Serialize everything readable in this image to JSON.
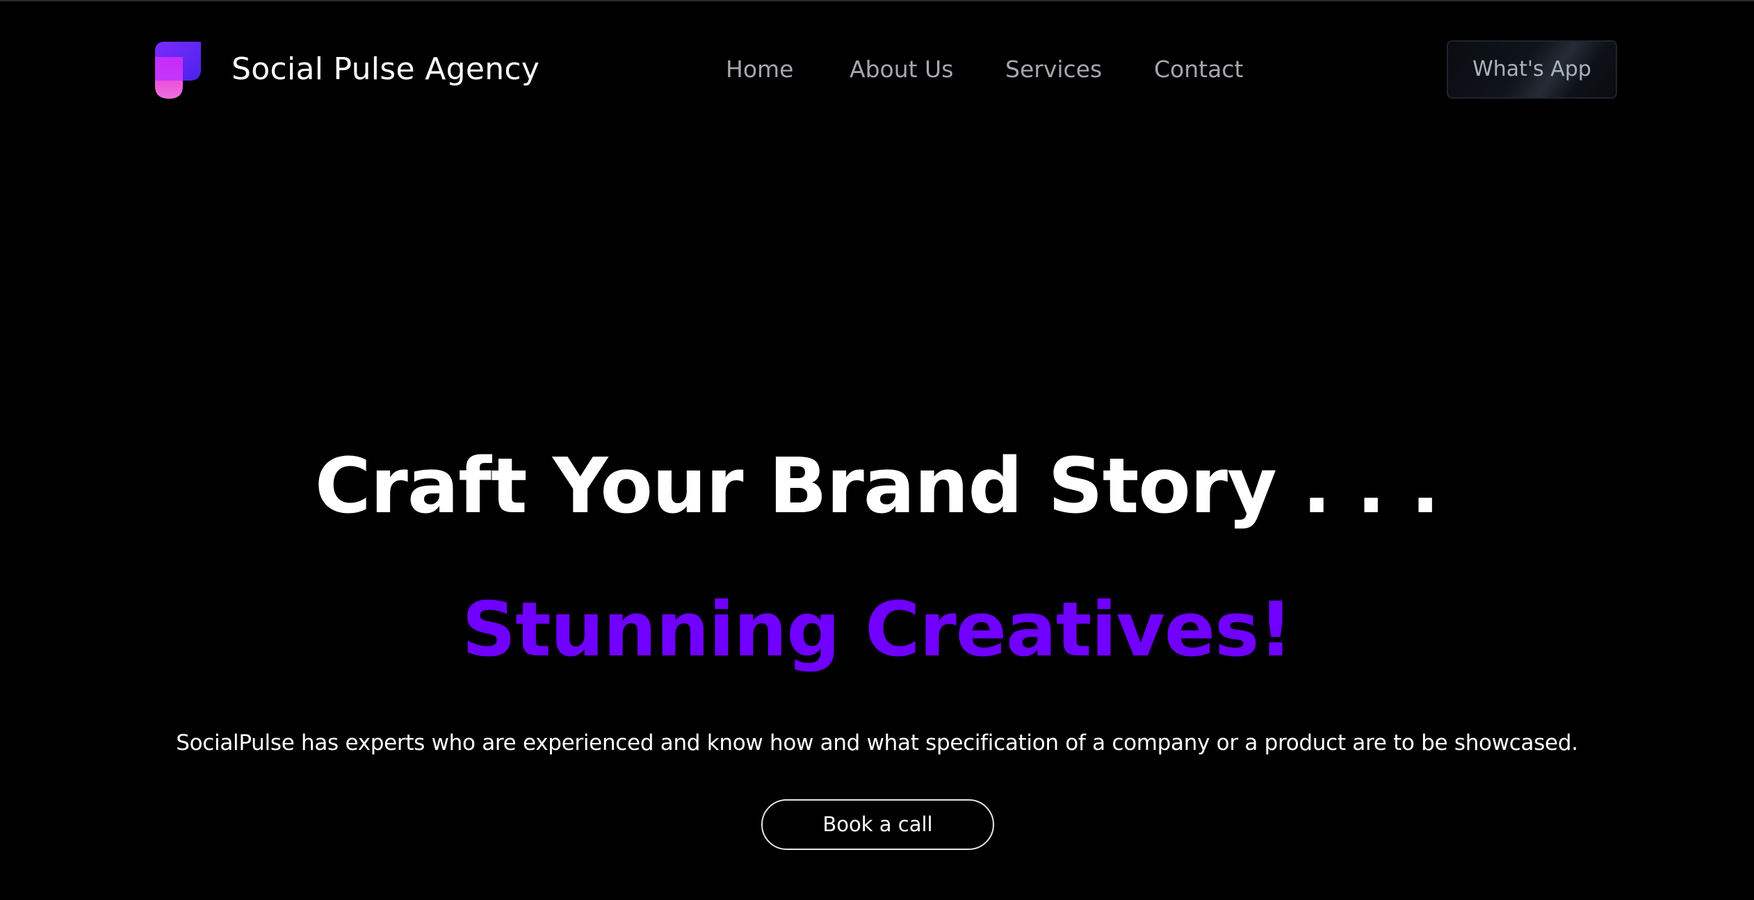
{
  "colors": {
    "background": "#000000",
    "accent": "#7000ff",
    "nav_text": "#a6a6ae",
    "logo_top": "#5b2bf5",
    "logo_bottom": "#ff3df0"
  },
  "navbar": {
    "logo_icon": "social-pulse-logo-icon",
    "brand": "Social Pulse Agency",
    "links": [
      "Home",
      "About Us",
      "Services",
      "Contact"
    ],
    "cta_label": "What's App"
  },
  "hero": {
    "title": "Craft Your Brand Story . . .",
    "highlight": "Stunning Creatives!",
    "description": "SocialPulse has experts who are experienced and know how and what specification of a company or a product are to be showcased.",
    "cta_label": "Book a call"
  }
}
